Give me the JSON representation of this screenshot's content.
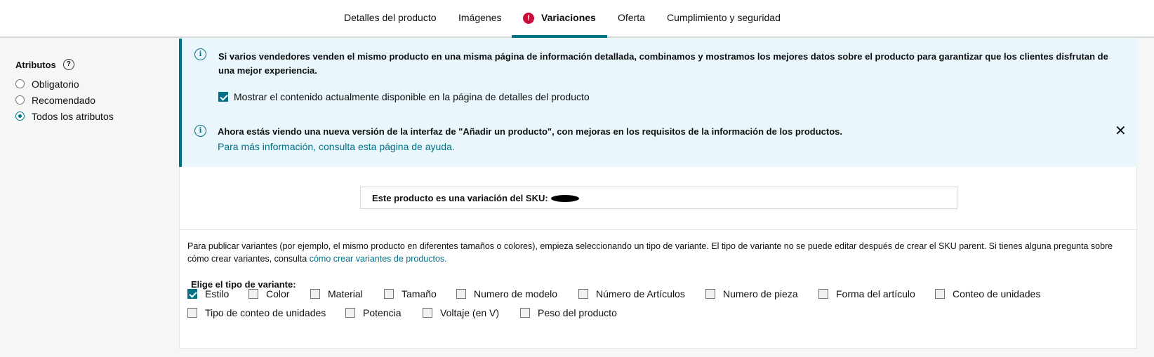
{
  "tabs": [
    {
      "label": "Detalles del producto"
    },
    {
      "label": "Imágenes"
    },
    {
      "label": "Variaciones",
      "alert": "!"
    },
    {
      "label": "Oferta"
    },
    {
      "label": "Cumplimiento y seguridad"
    }
  ],
  "sidebar": {
    "title": "Atributos",
    "help": "?",
    "options": [
      {
        "label": "Obligatorio",
        "checked": false
      },
      {
        "label": "Recomendado",
        "checked": false
      },
      {
        "label": "Todos los atributos",
        "checked": true
      }
    ]
  },
  "info": {
    "icon_glyph": "i",
    "message1": "Si varios vendedores venden el mismo producto en una misma página de información detallada, combinamos y mostramos los mejores datos sobre el producto para garantizar que los clientes disfrutan de una mejor experiencia.",
    "show_content_label": "Mostrar el contenido actualmente disponible en la página de detalles del producto",
    "message2": "Ahora estás viendo una nueva versión de la interfaz de \"Añadir un producto\", con mejoras en los requisitos de la información de los productos.",
    "help_link": "Para más información, consulta esta página de ayuda.",
    "close_glyph": "✕"
  },
  "variation": {
    "sku_label": "Este producto es una variación del SKU:",
    "description": "Para publicar variantes (por ejemplo, el mismo producto en diferentes tamaños o colores), empieza seleccionando un tipo de variante. El tipo de variante no se puede editar después de crear el SKU parent. Si tienes alguna pregunta sobre cómo crear variantes, consulta",
    "description_link": "cómo crear variantes de productos.",
    "variant_type_title": "Elige el tipo de variante:",
    "variant_types": [
      {
        "label": "Estilo",
        "checked": true
      },
      {
        "label": "Color",
        "checked": false
      },
      {
        "label": "Material",
        "checked": false
      },
      {
        "label": "Tamaño",
        "checked": false
      },
      {
        "label": "Numero de modelo",
        "checked": false
      },
      {
        "label": "Número de Artículos",
        "checked": false
      },
      {
        "label": "Numero de pieza",
        "checked": false
      },
      {
        "label": "Forma del artículo",
        "checked": false
      },
      {
        "label": "Conteo de unidades",
        "checked": false
      },
      {
        "label": "Tipo de conteo de unidades",
        "checked": false
      },
      {
        "label": "Potencia",
        "checked": false
      },
      {
        "label": "Voltaje (en V)",
        "checked": false
      },
      {
        "label": "Peso del producto",
        "checked": false
      }
    ]
  },
  "colors": {
    "accent": "#007185",
    "alert": "#cc0c39",
    "info_bg": "#e9f6fc"
  }
}
